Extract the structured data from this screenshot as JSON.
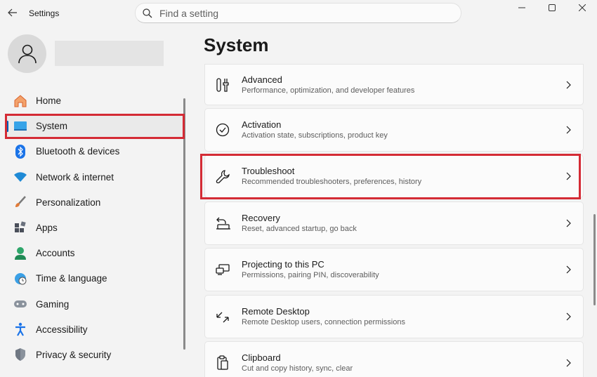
{
  "app": {
    "title": "Settings"
  },
  "search": {
    "placeholder": "Find a setting"
  },
  "page": {
    "title": "System"
  },
  "sidebar": {
    "items": [
      {
        "label": "Home",
        "icon": "home-icon",
        "color": "#e8713c"
      },
      {
        "label": "System",
        "icon": "system-icon",
        "color": "#2b88d8",
        "active": true
      },
      {
        "label": "Bluetooth & devices",
        "icon": "bluetooth-icon",
        "color": "#1a73e8"
      },
      {
        "label": "Network & internet",
        "icon": "wifi-icon",
        "color": "#1f8ad6"
      },
      {
        "label": "Personalization",
        "icon": "brush-icon",
        "color": "#e07b39"
      },
      {
        "label": "Apps",
        "icon": "apps-icon",
        "color": "#4a4f5a"
      },
      {
        "label": "Accounts",
        "icon": "accounts-icon",
        "color": "#2ea66a"
      },
      {
        "label": "Time & language",
        "icon": "globe-icon",
        "color": "#1f8ad6"
      },
      {
        "label": "Gaming",
        "icon": "gamepad-icon",
        "color": "#7d8590"
      },
      {
        "label": "Accessibility",
        "icon": "accessibility-icon",
        "color": "#1a73e8"
      },
      {
        "label": "Privacy & security",
        "icon": "shield-icon",
        "color": "#6f7782"
      }
    ]
  },
  "cards": [
    {
      "title": "Advanced",
      "subtitle": "Performance, optimization, and developer features",
      "icon": "advanced-tools-icon"
    },
    {
      "title": "Activation",
      "subtitle": "Activation state, subscriptions, product key",
      "icon": "activation-check-icon"
    },
    {
      "title": "Troubleshoot",
      "subtitle": "Recommended troubleshooters, preferences, history",
      "icon": "wrench-icon"
    },
    {
      "title": "Recovery",
      "subtitle": "Reset, advanced startup, go back",
      "icon": "recovery-icon"
    },
    {
      "title": "Projecting to this PC",
      "subtitle": "Permissions, pairing PIN, discoverability",
      "icon": "projecting-icon"
    },
    {
      "title": "Remote Desktop",
      "subtitle": "Remote Desktop users, connection permissions",
      "icon": "remote-desktop-icon"
    },
    {
      "title": "Clipboard",
      "subtitle": "Cut and copy history, sync, clear",
      "icon": "clipboard-icon"
    }
  ],
  "colors": {
    "highlight": "#d42b35",
    "accent": "#005fb8"
  }
}
